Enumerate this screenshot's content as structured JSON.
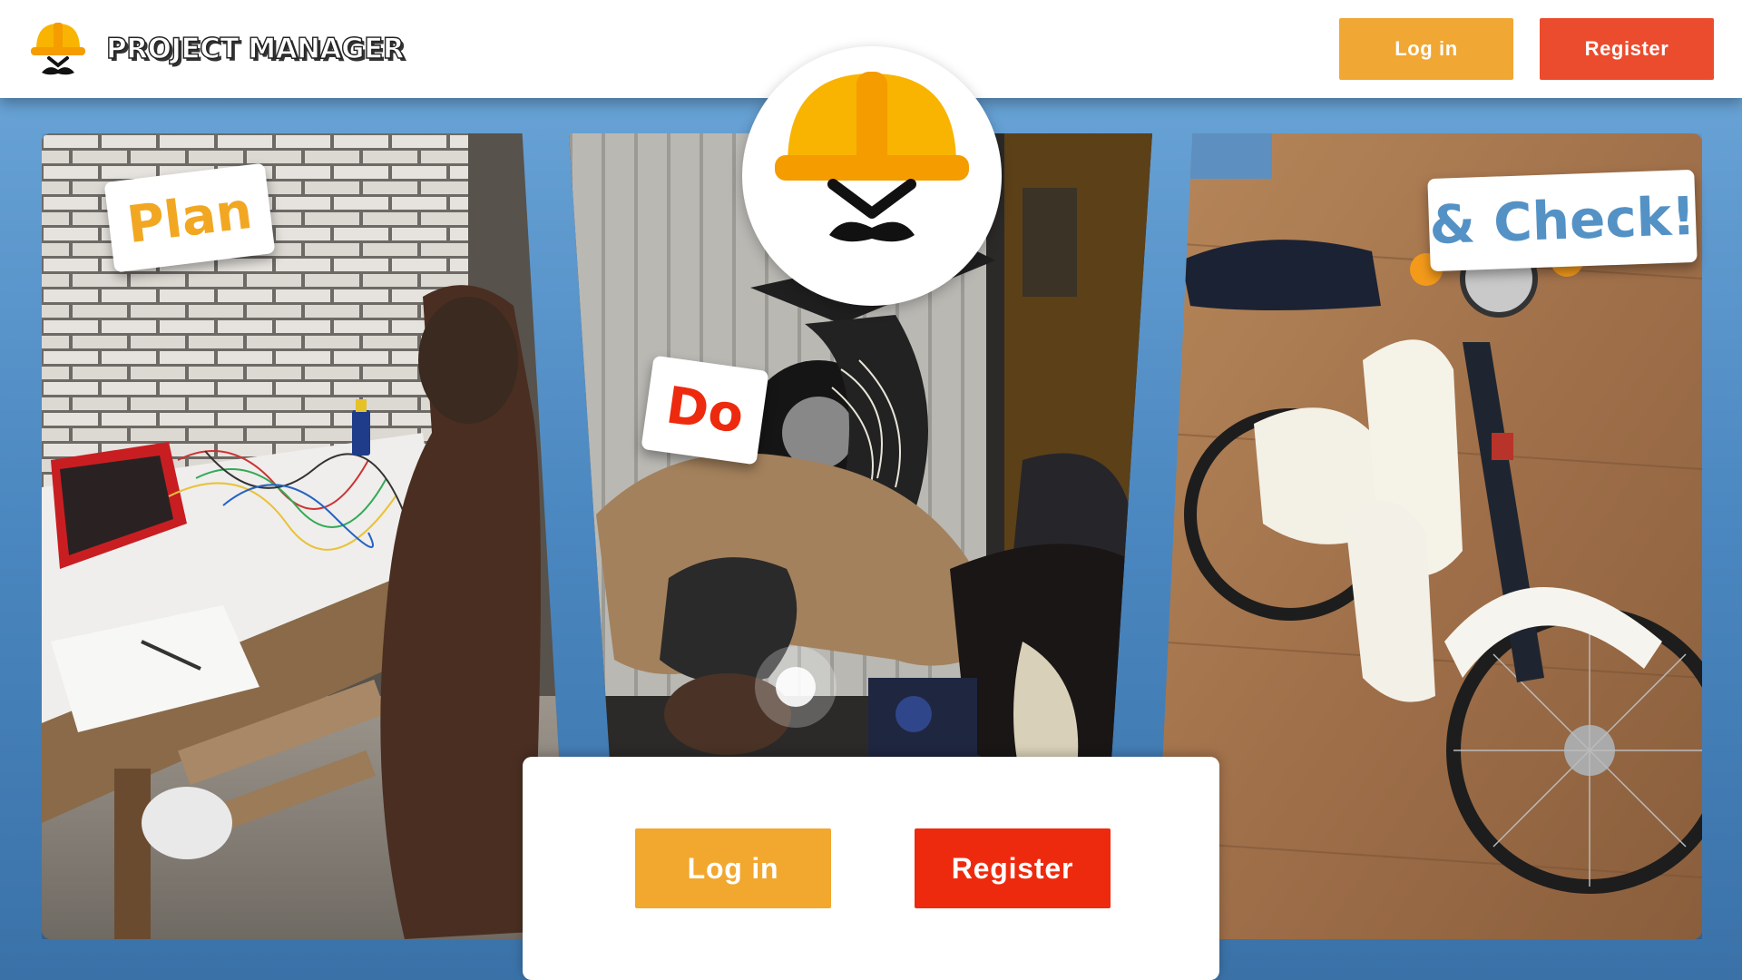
{
  "brand": {
    "name": "PROJECT MANAGER",
    "icon": "helmet-mustache-icon"
  },
  "header": {
    "login_label": "Log in",
    "register_label": "Register"
  },
  "panels": [
    {
      "id": "plan",
      "tag_label": "Plan",
      "photo": "workbench-with-wiring-photo"
    },
    {
      "id": "do",
      "tag_label": "Do",
      "photo": "person-repairing-motorcycle-photo"
    },
    {
      "id": "check",
      "tag_label": "& Check!",
      "photo": "restored-motorcycle-photo"
    }
  ],
  "auth_card": {
    "login_label": "Log in",
    "register_label": "Register"
  },
  "colors": {
    "accent_orange": "#f2a72e",
    "accent_red": "#ee2a0e",
    "header_login": "#f1a733",
    "header_register": "#ec4c2e",
    "tag_check_blue": "#5492c6",
    "page_background": "#4a86bf"
  }
}
